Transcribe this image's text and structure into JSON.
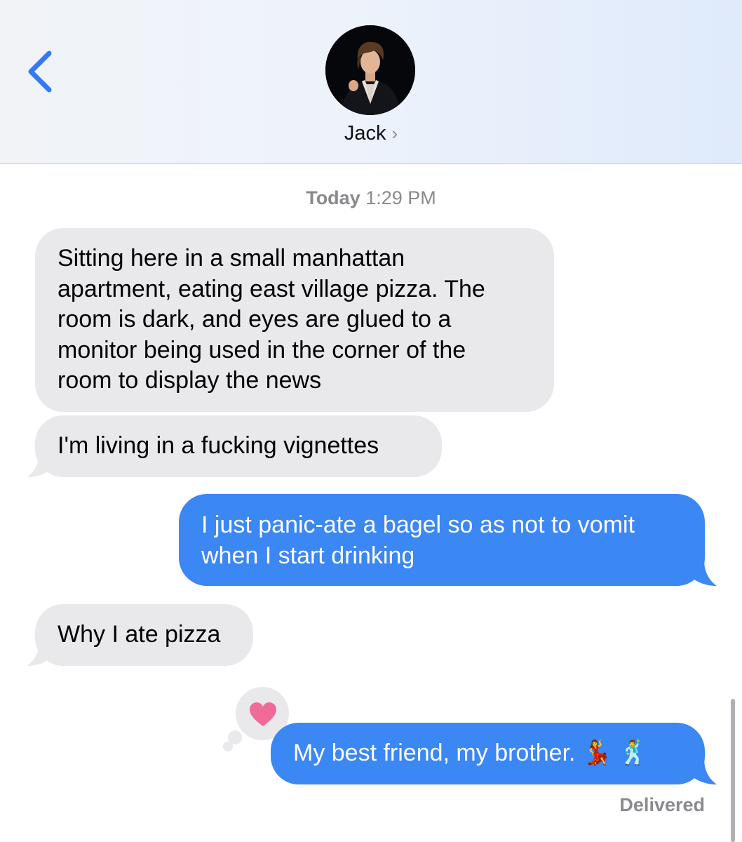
{
  "header": {
    "back_icon": "chevron-left-icon",
    "contact_name": "Jack",
    "contact_chevron": "›",
    "avatar": "contact-avatar-photo",
    "accent_color": "#3478f6"
  },
  "conversation": {
    "timestamp_day": "Today",
    "timestamp_time": "1:29 PM",
    "messages": [
      {
        "direction": "incoming",
        "lines": [
          "Sitting here in a small manhattan",
          "apartment, eating east village pizza. The",
          "room is dark, and eyes are glued to a",
          "monitor being used in the corner of the",
          "room to display the news"
        ]
      },
      {
        "direction": "incoming",
        "lines": [
          "I'm living in a fucking vignettes"
        ]
      },
      {
        "direction": "outgoing",
        "lines": [
          "I just panic-ate a bagel so as not to vomit",
          "when I start drinking"
        ]
      },
      {
        "direction": "incoming",
        "lines": [
          "Why I ate pizza"
        ]
      },
      {
        "direction": "outgoing",
        "text": "My best friend, my brother.",
        "emoji": "💃 🕺",
        "reaction": "heart-icon"
      }
    ],
    "status": "Delivered"
  },
  "colors": {
    "incoming_bubble": "#e9e9eb",
    "outgoing_bubble": "#3b87f4",
    "heart": "#ef6b98"
  }
}
